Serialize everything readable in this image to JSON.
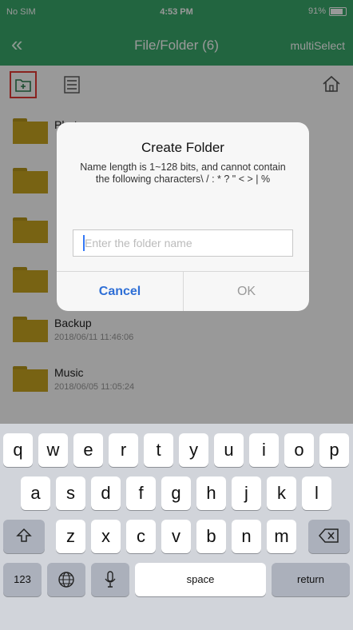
{
  "status_bar": {
    "carrier": "No SIM",
    "time": "4:53 PM",
    "battery": "91%"
  },
  "nav_bar": {
    "back_icon": "double-chevron-left-icon",
    "title": "File/Folder (6)",
    "right_action": "multiSelect"
  },
  "toolbar": {
    "new_folder_icon": "new-folder-icon",
    "list_icon": "list-icon",
    "home_icon": "home-icon"
  },
  "files": [
    {
      "name": "Photos",
      "date": ""
    },
    {
      "name": "",
      "date": ""
    },
    {
      "name": "",
      "date": ""
    },
    {
      "name": "",
      "date": ""
    },
    {
      "name": "Backup",
      "date": "2018/06/11 11:46:06"
    },
    {
      "name": "Music",
      "date": "2018/06/05 11:05:24"
    }
  ],
  "dialog": {
    "title": "Create Folder",
    "message": "Name length is 1~128 bits, and cannot contain the following characters\\ / : * ? \" < > | %",
    "input_placeholder": "Enter the folder name",
    "input_value": "",
    "cancel_label": "Cancel",
    "ok_label": "OK"
  },
  "keyboard": {
    "row1": [
      "q",
      "w",
      "e",
      "r",
      "t",
      "y",
      "u",
      "i",
      "o",
      "p"
    ],
    "row2": [
      "a",
      "s",
      "d",
      "f",
      "g",
      "h",
      "j",
      "k",
      "l"
    ],
    "row3": [
      "z",
      "x",
      "c",
      "v",
      "b",
      "n",
      "m"
    ],
    "numbers_label": "123",
    "space_label": "space",
    "return_label": "return",
    "shift_icon": "shift-icon",
    "backspace_icon": "backspace-icon",
    "globe_icon": "globe-icon",
    "mic_icon": "microphone-icon"
  },
  "colors": {
    "accent": "#3aa86b",
    "link": "#2f6fd6",
    "folder": "#c9a520",
    "highlight": "#e53935"
  }
}
